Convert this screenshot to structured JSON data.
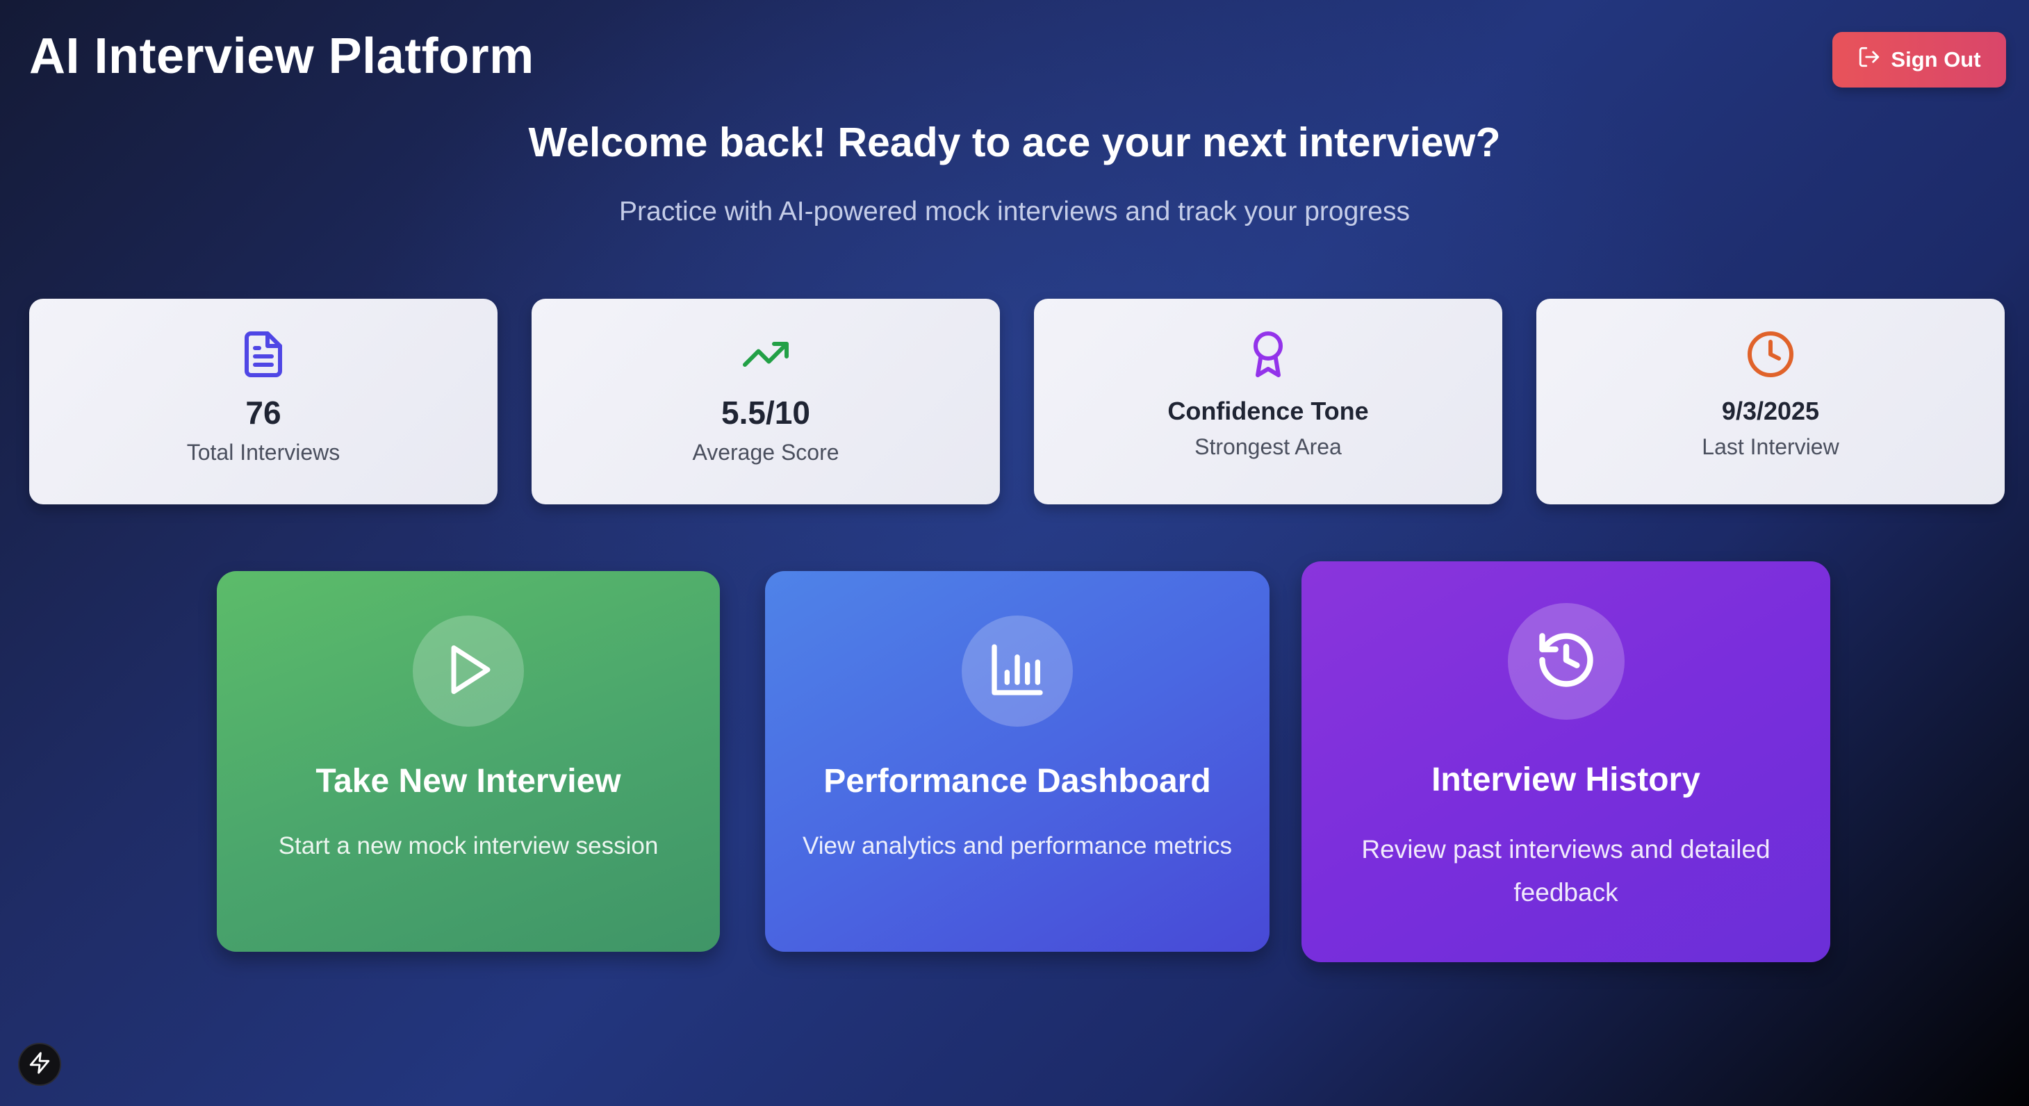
{
  "header": {
    "app_title": "AI Interview Platform",
    "sign_out_label": "Sign Out",
    "sign_out_color": "#e8535a"
  },
  "hero": {
    "title": "Welcome back! Ready to ace your next interview?",
    "subtitle": "Practice with AI-powered mock interviews and track your progress"
  },
  "stats": [
    {
      "icon": "document-icon",
      "icon_color": "#4f46e5",
      "value": "76",
      "label": "Total Interviews"
    },
    {
      "icon": "trending-up-icon",
      "icon_color": "#22a046",
      "value": "5.5/10",
      "label": "Average Score"
    },
    {
      "icon": "award-icon",
      "icon_color": "#9333ea",
      "value": "Confidence Tone",
      "label": "Strongest Area"
    },
    {
      "icon": "clock-icon",
      "icon_color": "#e0622a",
      "value": "9/3/2025",
      "label": "Last Interview"
    }
  ],
  "actions": [
    {
      "icon": "play-icon",
      "title": "Take New Interview",
      "description": "Start a new mock interview session",
      "color": "#4aa56c"
    },
    {
      "icon": "bar-chart-icon",
      "title": "Performance Dashboard",
      "description": "View analytics and performance metrics",
      "color": "#4a68e2"
    },
    {
      "icon": "history-icon",
      "title": "Interview History",
      "description": "Review past interviews and detailed feedback",
      "color": "#7a2edc"
    }
  ],
  "footer": {
    "badge_icon": "lightning-bolt-icon"
  }
}
